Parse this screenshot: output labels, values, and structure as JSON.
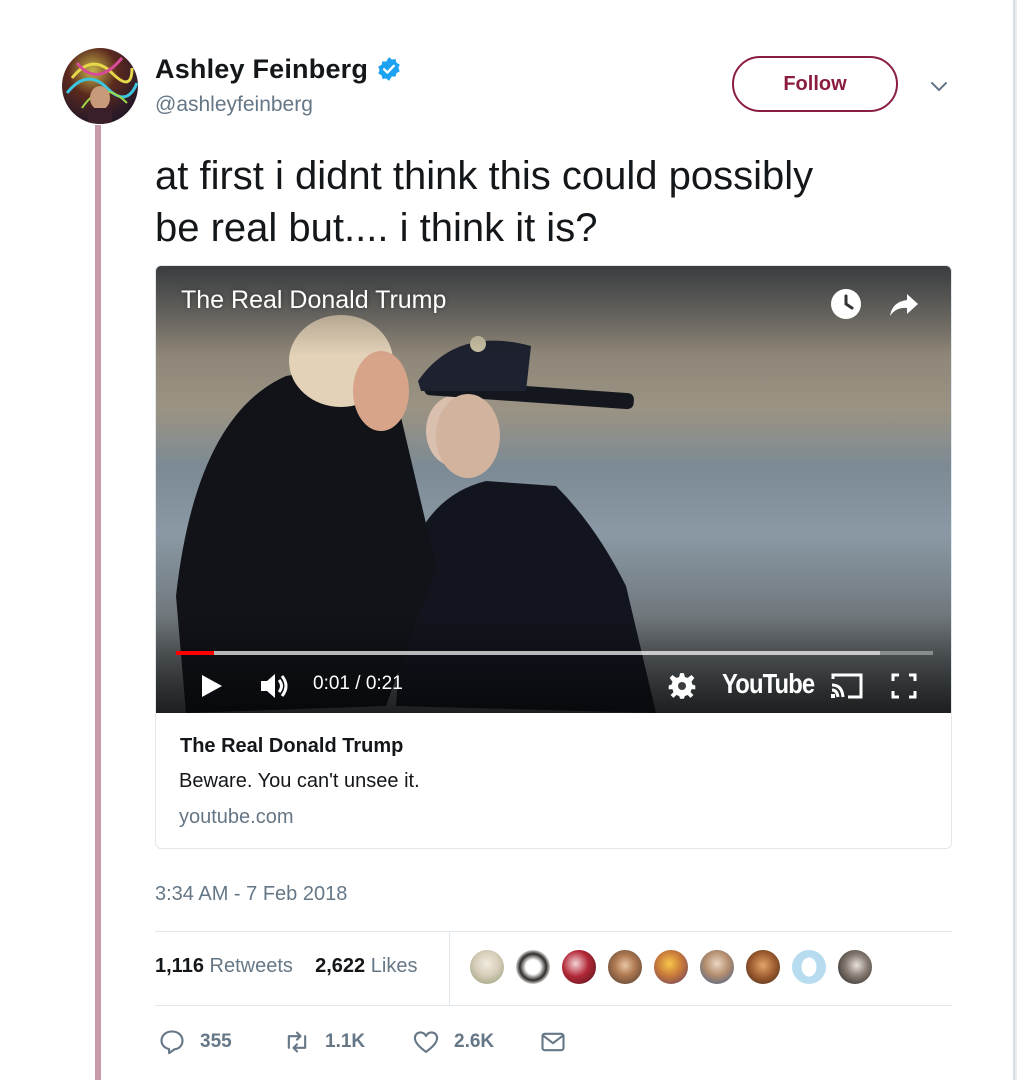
{
  "user": {
    "display_name": "Ashley Feinberg",
    "handle": "@ashleyfeinberg",
    "verified_icon": "verified-badge-icon",
    "avatar_icon": "avatar"
  },
  "follow_button": {
    "label": "Follow",
    "color": "#8b1d3f"
  },
  "tweet": {
    "text_line1": "at first i didnt think this could possibly",
    "text_line2": "be real but.... i think it is?",
    "timestamp": "3:34 AM - 7 Feb 2018"
  },
  "video": {
    "title": "The Real Donald Trump",
    "time_readout": "0:01 / 0:21",
    "progress_played": 0.05,
    "progress_loaded": 0.93,
    "brand": "YouTube",
    "icons": [
      "clock-icon",
      "share-icon",
      "play-icon",
      "volume-icon",
      "settings-icon",
      "cast-icon",
      "fullscreen-icon"
    ]
  },
  "link_card": {
    "title": "The Real Donald Trump",
    "description": "Beware. You can't unsee it.",
    "domain": "youtube.com"
  },
  "stats": {
    "retweets_count": "1,116",
    "retweets_label": "Retweets",
    "likes_count": "2,622",
    "likes_label": "Likes"
  },
  "actions": {
    "reply_count": "355",
    "retweet_count": "1.1K",
    "like_count": "2.6K"
  },
  "colors": {
    "thread_line": "#c99aa9",
    "secondary_text": "#657786",
    "progress_red": "#ff0000",
    "verified_blue": "#1da1f2"
  }
}
